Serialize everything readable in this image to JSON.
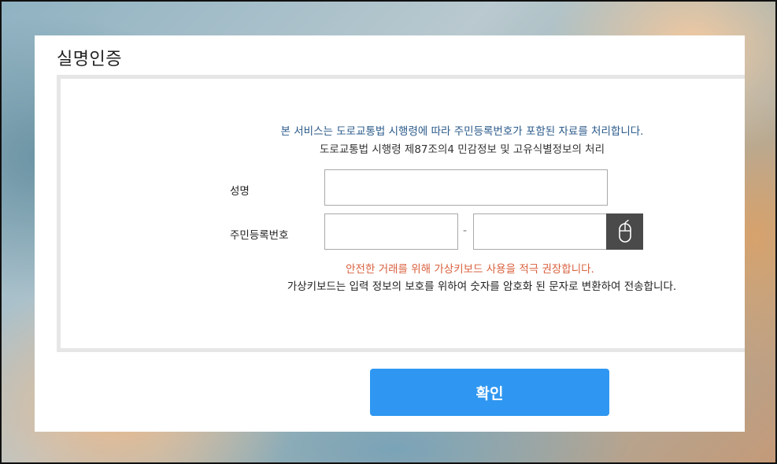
{
  "dialog": {
    "title": "실명인증"
  },
  "notice": {
    "line1": "본 서비스는 도로교통법 시행령에 따라 주민등록번호가 포함된 자료를 처리합니다.",
    "line2": "도로교통법 시행령 제87조의4 민감정보 및 고유식별정보의 처리"
  },
  "form": {
    "name_label": "성명",
    "name_value": "",
    "rrn_label": "주민등록번호",
    "rrn_front_value": "",
    "rrn_separator": "-",
    "rrn_back_value": "",
    "virtual_keyboard_icon": "mouse-icon"
  },
  "keyboard_notice": {
    "warning": "안전한 거래를 위해 가상키보드 사용을 적극 권장합니다.",
    "info": "가상키보드는 입력 정보의 보호를 위하여 숫자를 암호화 된 문자로 변환하여 전송합니다."
  },
  "actions": {
    "confirm_label": "확인"
  },
  "colors": {
    "notice_blue": "#2a5a8a",
    "warning_orange": "#d9603d",
    "confirm_button": "#2f97f1",
    "keyboard_button": "#4a4a4a"
  }
}
